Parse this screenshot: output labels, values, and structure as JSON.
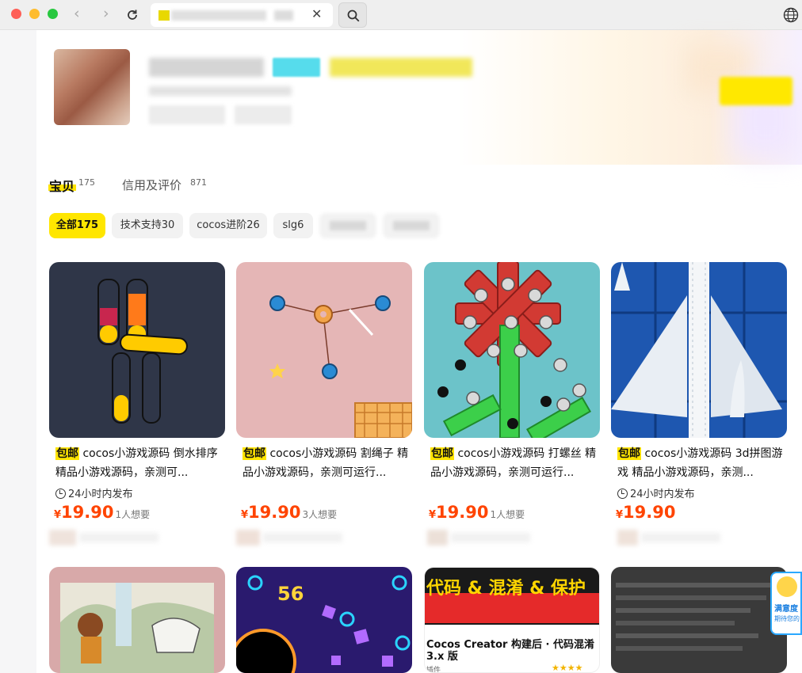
{
  "browser": {
    "icons": {
      "back": "chevron-left-icon",
      "forward": "chevron-right-icon",
      "reload": "reload-icon",
      "close": "close-icon",
      "search": "search-icon",
      "globe": "globe-icon"
    },
    "close_glyph": "✕"
  },
  "shop": {
    "tabs": [
      {
        "label": "宝贝",
        "count": "175"
      },
      {
        "label": "信用及评价",
        "count": "871"
      }
    ],
    "filters": [
      {
        "label": "全部175",
        "active": true
      },
      {
        "label": "技术支持30",
        "active": false
      },
      {
        "label": "cocos进阶26",
        "active": false
      },
      {
        "label": "slg6",
        "active": false
      }
    ]
  },
  "products": [
    {
      "badge": "包邮",
      "title": " cocos小游戏源码 倒水排序 精品小游戏源码，亲测可...",
      "tag": "24小时内发布",
      "currency": "¥",
      "price": "19.90",
      "wants": "1人想要"
    },
    {
      "badge": "包邮",
      "title": " cocos小游戏源码 割绳子 精品小游戏源码，亲测可运行...",
      "tag": "",
      "currency": "¥",
      "price": "19.90",
      "wants": "3人想要"
    },
    {
      "badge": "包邮",
      "title": " cocos小游戏源码 打螺丝 精品小游戏源码，亲测可运行...",
      "tag": "",
      "currency": "¥",
      "price": "19.90",
      "wants": "1人想要"
    },
    {
      "badge": "包邮",
      "title": " cocos小游戏源码 3d拼图游戏 精品小游戏源码，亲测...",
      "tag": "24小时内发布",
      "currency": "¥",
      "price": "19.90",
      "wants": ""
    }
  ],
  "row2": {
    "card2_text": "56",
    "card3_banner": "代码 & 混淆 & 保护",
    "card3_title": "Cocos Creator 构建后 · 代码混淆 3.x 版",
    "card3_sub": "插件",
    "card3_stars": "★★★★",
    "card4_tag": "满意度",
    "card4_tag2": "期待您的"
  },
  "colors": {
    "accent": "#ffe400",
    "price": "#ff4400"
  }
}
